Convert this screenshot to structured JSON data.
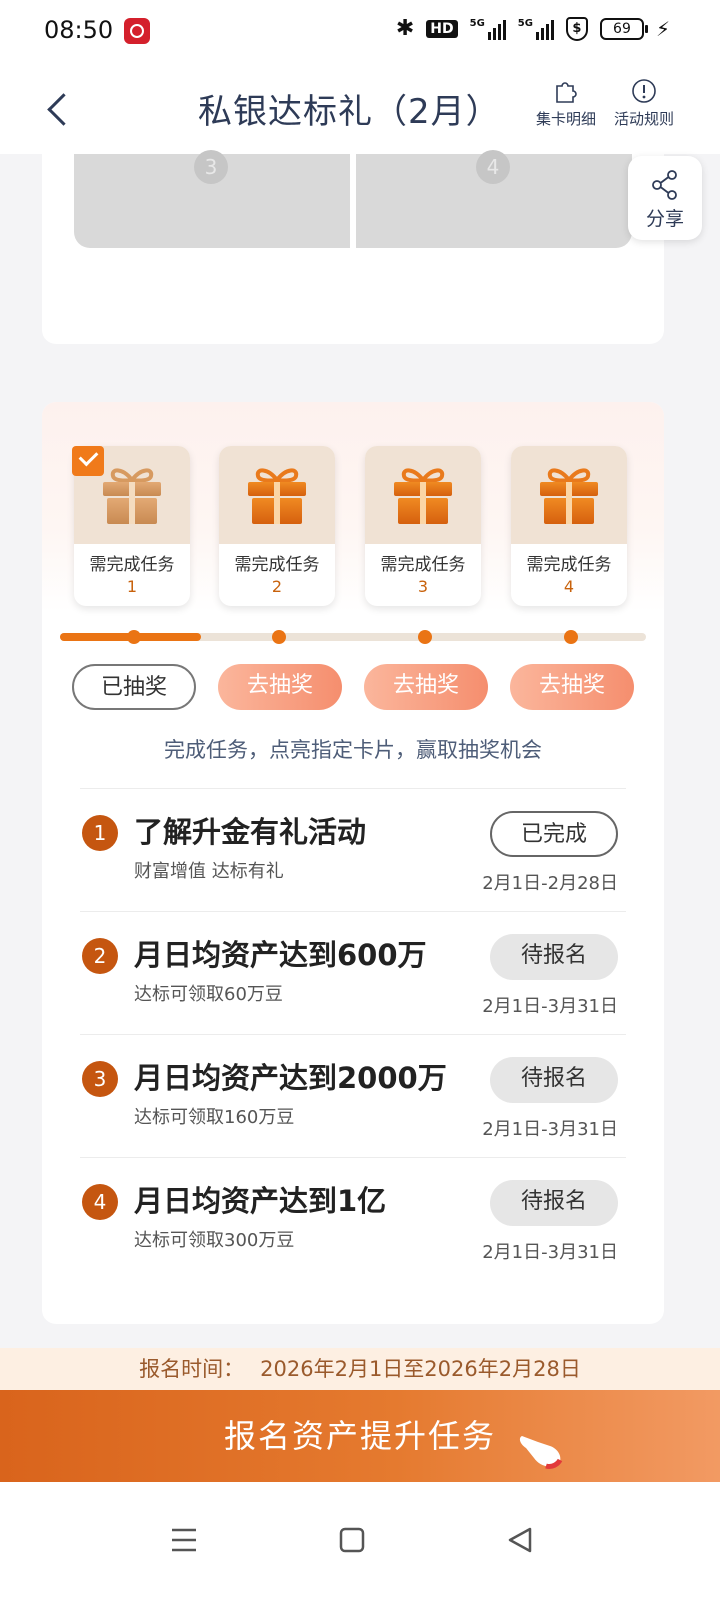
{
  "status_bar": {
    "time": "08:50",
    "hd_label": "HD",
    "signal_1": "5G",
    "signal_2": "5G",
    "shield_label": "$",
    "battery": "69"
  },
  "header": {
    "title": "私银达标礼（2月）",
    "actions": [
      {
        "label": "集卡明细",
        "icon": "puzzle-icon"
      },
      {
        "label": "活动规则",
        "icon": "info-icon"
      }
    ]
  },
  "share": {
    "label": "分享",
    "icon": "share-icon"
  },
  "top_card": {
    "slots": [
      {
        "number": "3"
      },
      {
        "number": "4"
      }
    ]
  },
  "gifts": [
    {
      "label": "需完成任务",
      "number": "1",
      "checked": true
    },
    {
      "label": "需完成任务",
      "number": "2",
      "checked": false
    },
    {
      "label": "需完成任务",
      "number": "3",
      "checked": false
    },
    {
      "label": "需完成任务",
      "number": "4",
      "checked": false
    }
  ],
  "progress": {
    "fraction": 0.24
  },
  "draw_buttons": [
    {
      "label": "已抽奖",
      "state": "done"
    },
    {
      "label": "去抽奖",
      "state": "active"
    },
    {
      "label": "去抽奖",
      "state": "active"
    },
    {
      "label": "去抽奖",
      "state": "active"
    }
  ],
  "draw_tip": "完成任务，点亮指定卡片，赢取抽奖机会",
  "tasks": [
    {
      "index": "1",
      "title": "了解升金有礼活动",
      "subtitle": "财富增值 达标有礼",
      "button": "已完成",
      "status": "done",
      "date": "2月1日-2月28日"
    },
    {
      "index": "2",
      "title": "月日均资产达到600万",
      "subtitle": "达标可领取60万豆",
      "button": "待报名",
      "status": "pending",
      "date": "2月1日-3月31日"
    },
    {
      "index": "3",
      "title": "月日均资产达到2000万",
      "subtitle": "达标可领取160万豆",
      "button": "待报名",
      "status": "pending",
      "date": "2月1日-3月31日"
    },
    {
      "index": "4",
      "title": "月日均资产达到1亿",
      "subtitle": "达标可领取300万豆",
      "button": "待报名",
      "status": "pending",
      "date": "2月1日-3月31日"
    }
  ],
  "register": {
    "label": "报名时间：",
    "value": "2026年2月1日至2026年2月28日"
  },
  "cta": {
    "label": "报名资产提升任务"
  },
  "colors": {
    "accent": "#ea7414",
    "title_text": "#2e3b57",
    "task_index": "#c55610",
    "draw_gradient_start": "#fbb69c",
    "draw_gradient_end": "#f58e6e"
  }
}
